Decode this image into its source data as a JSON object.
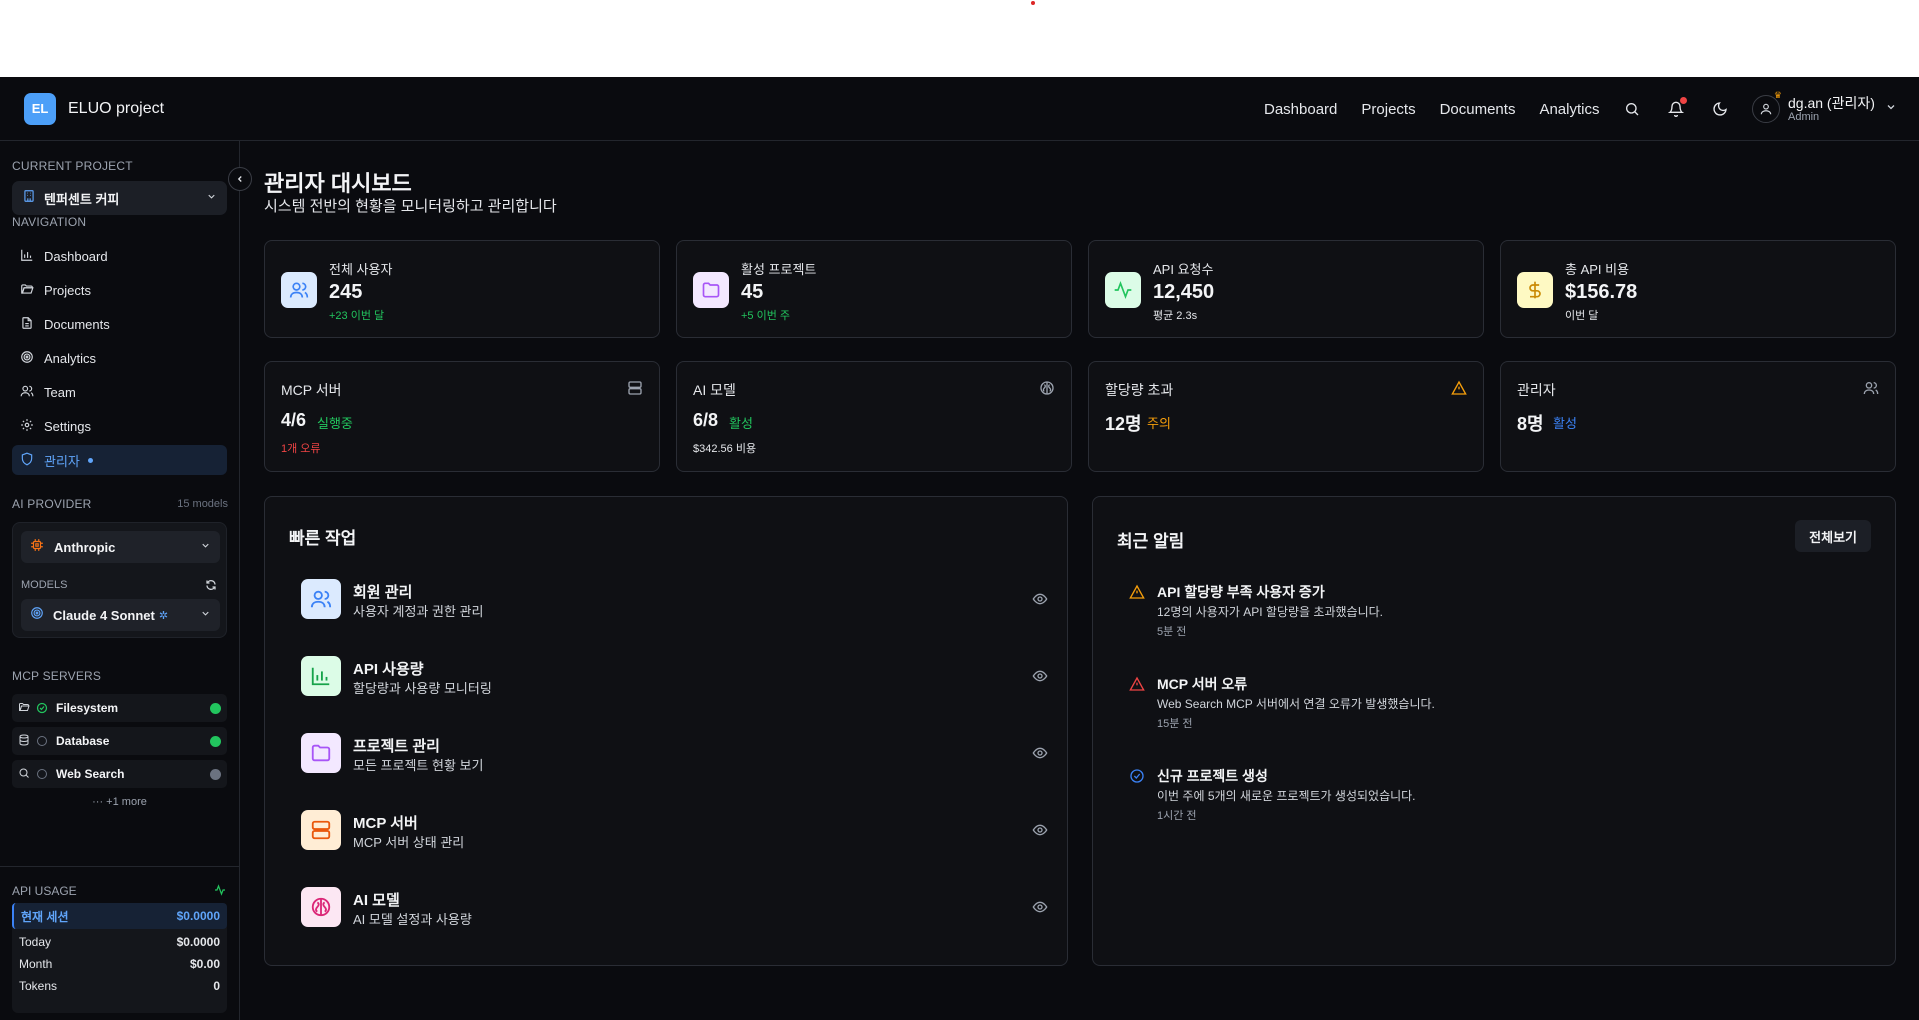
{
  "header": {
    "logo_text": "EL",
    "project_name": "ELUO project",
    "nav": [
      "Dashboard",
      "Projects",
      "Documents",
      "Analytics"
    ],
    "user_name": "dg.an (관리자)",
    "user_role": "Admin"
  },
  "sidebar": {
    "current_project_title": "CURRENT PROJECT",
    "current_project": "텐퍼센트 커피",
    "navigation_title": "NAVIGATION",
    "nav_items": [
      {
        "label": "Dashboard",
        "icon": "bar-chart-icon"
      },
      {
        "label": "Projects",
        "icon": "folder-open-icon"
      },
      {
        "label": "Documents",
        "icon": "document-icon"
      },
      {
        "label": "Analytics",
        "icon": "target-icon"
      },
      {
        "label": "Team",
        "icon": "users-icon"
      },
      {
        "label": "Settings",
        "icon": "gear-icon"
      },
      {
        "label": "관리자",
        "icon": "shield-icon"
      }
    ],
    "ai_provider_title": "AI PROVIDER",
    "models_count": "15 models",
    "provider": "Anthropic",
    "models_title": "MODELS",
    "model": "Claude 4 Sonnet",
    "mcp_title": "MCP SERVERS",
    "mcp_servers": [
      {
        "name": "Filesystem",
        "status_color": "#22c55e",
        "state": "checked"
      },
      {
        "name": "Database",
        "status_color": "#22c55e",
        "state": "idle"
      },
      {
        "name": "Web Search",
        "status_color": "#6b7280",
        "state": "idle"
      }
    ],
    "more_text": "··· +1 more",
    "api_usage_title": "API USAGE",
    "usage": {
      "session_label": "현재 세션",
      "session_value": "$0.0000",
      "rows": [
        {
          "label": "Today",
          "value": "$0.0000"
        },
        {
          "label": "Month",
          "value": "$0.00"
        },
        {
          "label": "Tokens",
          "value": "0"
        }
      ]
    }
  },
  "main": {
    "title": "관리자 대시보드",
    "subtitle": "시스템 전반의 현황을 모니터링하고 관리합니다",
    "stats": [
      {
        "label": "전체 사용자",
        "value": "245",
        "note": "+23 이번 달",
        "note_color": "#22c55e",
        "icon": "users-icon",
        "bg": "#dbeafe",
        "fg": "#3b82f6"
      },
      {
        "label": "활성 프로젝트",
        "value": "45",
        "note": "+5 이번 주",
        "note_color": "#22c55e",
        "icon": "folder-icon",
        "bg": "#f3e8ff",
        "fg": "#a855f7"
      },
      {
        "label": "API 요청수",
        "value": "12,450",
        "note": "평균 2.3s",
        "note_color": "#e5e7eb",
        "icon": "activity-icon",
        "bg": "#dcfce7",
        "fg": "#22c55e"
      },
      {
        "label": "총 API 비용",
        "value": "$156.78",
        "note": "이번 달",
        "note_color": "#e5e7eb",
        "icon": "dollar-icon",
        "bg": "#fef9c3",
        "fg": "#ca8a04"
      }
    ],
    "stats2": [
      {
        "label": "MCP 서버",
        "value": "4/6",
        "status": "실행중",
        "status_color": "#22c55e",
        "sub": "1개 오류",
        "sub_color": "#ef4444",
        "icon": "server-icon"
      },
      {
        "label": "AI 모델",
        "value": "6/8",
        "status": "활성",
        "status_color": "#22c55e",
        "sub": "$342.56 비용",
        "sub_color": "#e5e7eb",
        "icon": "brain-icon"
      },
      {
        "label": "할당량 초과",
        "value": "12명",
        "status": "주의",
        "status_color": "#f59e0b",
        "sub": "",
        "sub_color": "#e5e7eb",
        "icon": "warning-icon"
      },
      {
        "label": "관리자",
        "value": "8명",
        "status": "활성",
        "status_color": "#3b82f6",
        "sub": "",
        "sub_color": "#e5e7eb",
        "icon": "users-icon"
      }
    ],
    "quick_actions_title": "빠른 작업",
    "quick_actions": [
      {
        "title": "회원 관리",
        "desc": "사용자 계정과 권한 관리",
        "icon": "users-icon",
        "bg": "#dbeafe",
        "fg": "#3b82f6"
      },
      {
        "title": "API 사용량",
        "desc": "할당량과 사용량 모니터링",
        "icon": "bar-chart-icon",
        "bg": "#dcfce7",
        "fg": "#16a34a"
      },
      {
        "title": "프로젝트 관리",
        "desc": "모든 프로젝트 현황 보기",
        "icon": "folder-icon",
        "bg": "#f3e8ff",
        "fg": "#a855f7"
      },
      {
        "title": "MCP 서버",
        "desc": "MCP 서버 상태 관리",
        "icon": "server-icon",
        "bg": "#ffedd5",
        "fg": "#ea580c"
      },
      {
        "title": "AI 모델",
        "desc": "AI 모델 설정과 사용량",
        "icon": "brain-icon",
        "bg": "#fce7f3",
        "fg": "#db2777"
      }
    ],
    "notifications_title": "최근 알림",
    "view_all": "전체보기",
    "notifications": [
      {
        "title": "API 할당량 부족 사용자 증가",
        "desc": "12명의 사용자가 API 할당량을 초과했습니다.",
        "time": "5분 전",
        "icon": "warning-icon",
        "color": "#f59e0b"
      },
      {
        "title": "MCP 서버 오류",
        "desc": "Web Search MCP 서버에서 연결 오류가 발생했습니다.",
        "time": "15분 전",
        "icon": "warning-icon",
        "color": "#ef4444"
      },
      {
        "title": "신규 프로젝트 생성",
        "desc": "이번 주에 5개의 새로운 프로젝트가 생성되었습니다.",
        "time": "1시간 전",
        "icon": "check-circle-icon",
        "color": "#3b82f6"
      }
    ]
  }
}
